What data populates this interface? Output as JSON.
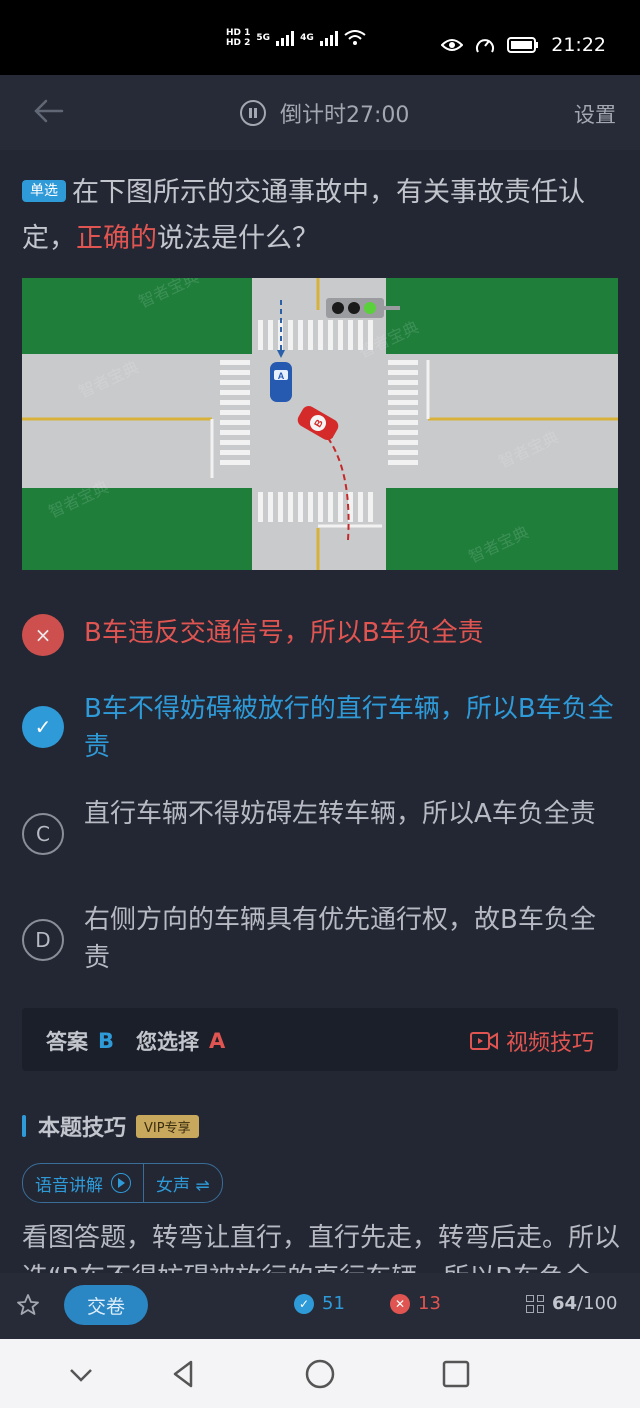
{
  "status": {
    "time": "21:22",
    "hd1": "HD 1",
    "hd2": "HD 2",
    "net1": "5G",
    "net2": "4G"
  },
  "header": {
    "timer": "倒计时27:00",
    "settings": "设置"
  },
  "question": {
    "badge": "单选",
    "text_before": "在下图所示的交通事故中，有关事故责任认定，",
    "highlight": "正确的",
    "text_after": "说法是什么？"
  },
  "scene": {
    "car_a": "A",
    "car_b": "B",
    "watermark": "智者宝典"
  },
  "options": [
    {
      "state": "wrong",
      "icon": "×",
      "text": "B车违反交通信号，所以B车负全责"
    },
    {
      "state": "correct",
      "icon": "✓",
      "text": "B车不得妨碍被放行的直行车辆，所以B车负全责"
    },
    {
      "state": "plain",
      "icon": "C",
      "text": "直行车辆不得妨碍左转车辆，所以A车负全责"
    },
    {
      "state": "plain",
      "icon": "D",
      "text": "右侧方向的车辆具有优先通行权，故B车负全责"
    }
  ],
  "answer": {
    "label": "答案",
    "correct": "B",
    "chosen_label": "您选择",
    "chosen": "A",
    "video": "视频技巧"
  },
  "tip": {
    "title": "本题技巧",
    "vip": "VIP专享",
    "voice": "语音讲解",
    "gender": "女声 ⇌",
    "text": "看图答题，转弯让直行，直行先走，转弯后走。所以选“B车不得妨碍被放行的直行车辆，所以B车负全责”"
  },
  "bottom": {
    "submit": "交卷",
    "right_count": "51",
    "wrong_count": "13",
    "progress_current": "64",
    "progress_total": "/100"
  },
  "colors": {
    "background": "#222733",
    "accent": "#2f9ad8",
    "error": "#e05551",
    "grass": "#1e7e3a",
    "road": "#c9cacc"
  }
}
